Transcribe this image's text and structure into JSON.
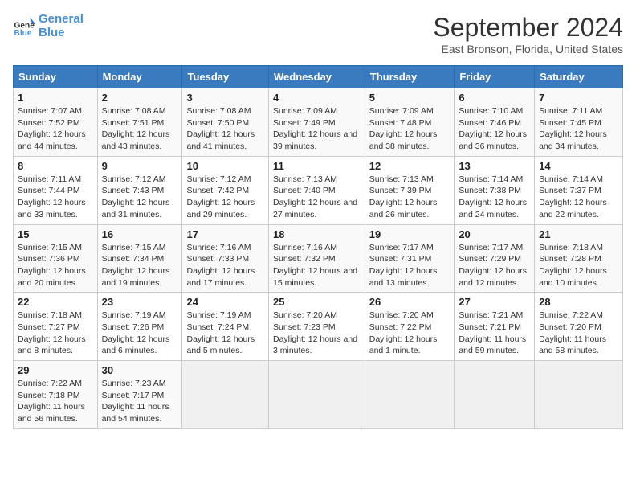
{
  "header": {
    "logo_line1": "General",
    "logo_line2": "Blue",
    "title": "September 2024",
    "subtitle": "East Bronson, Florida, United States"
  },
  "columns": [
    "Sunday",
    "Monday",
    "Tuesday",
    "Wednesday",
    "Thursday",
    "Friday",
    "Saturday"
  ],
  "weeks": [
    [
      {
        "day": "1",
        "sunrise": "Sunrise: 7:07 AM",
        "sunset": "Sunset: 7:52 PM",
        "daylight": "Daylight: 12 hours and 44 minutes."
      },
      {
        "day": "2",
        "sunrise": "Sunrise: 7:08 AM",
        "sunset": "Sunset: 7:51 PM",
        "daylight": "Daylight: 12 hours and 43 minutes."
      },
      {
        "day": "3",
        "sunrise": "Sunrise: 7:08 AM",
        "sunset": "Sunset: 7:50 PM",
        "daylight": "Daylight: 12 hours and 41 minutes."
      },
      {
        "day": "4",
        "sunrise": "Sunrise: 7:09 AM",
        "sunset": "Sunset: 7:49 PM",
        "daylight": "Daylight: 12 hours and 39 minutes."
      },
      {
        "day": "5",
        "sunrise": "Sunrise: 7:09 AM",
        "sunset": "Sunset: 7:48 PM",
        "daylight": "Daylight: 12 hours and 38 minutes."
      },
      {
        "day": "6",
        "sunrise": "Sunrise: 7:10 AM",
        "sunset": "Sunset: 7:46 PM",
        "daylight": "Daylight: 12 hours and 36 minutes."
      },
      {
        "day": "7",
        "sunrise": "Sunrise: 7:11 AM",
        "sunset": "Sunset: 7:45 PM",
        "daylight": "Daylight: 12 hours and 34 minutes."
      }
    ],
    [
      {
        "day": "8",
        "sunrise": "Sunrise: 7:11 AM",
        "sunset": "Sunset: 7:44 PM",
        "daylight": "Daylight: 12 hours and 33 minutes."
      },
      {
        "day": "9",
        "sunrise": "Sunrise: 7:12 AM",
        "sunset": "Sunset: 7:43 PM",
        "daylight": "Daylight: 12 hours and 31 minutes."
      },
      {
        "day": "10",
        "sunrise": "Sunrise: 7:12 AM",
        "sunset": "Sunset: 7:42 PM",
        "daylight": "Daylight: 12 hours and 29 minutes."
      },
      {
        "day": "11",
        "sunrise": "Sunrise: 7:13 AM",
        "sunset": "Sunset: 7:40 PM",
        "daylight": "Daylight: 12 hours and 27 minutes."
      },
      {
        "day": "12",
        "sunrise": "Sunrise: 7:13 AM",
        "sunset": "Sunset: 7:39 PM",
        "daylight": "Daylight: 12 hours and 26 minutes."
      },
      {
        "day": "13",
        "sunrise": "Sunrise: 7:14 AM",
        "sunset": "Sunset: 7:38 PM",
        "daylight": "Daylight: 12 hours and 24 minutes."
      },
      {
        "day": "14",
        "sunrise": "Sunrise: 7:14 AM",
        "sunset": "Sunset: 7:37 PM",
        "daylight": "Daylight: 12 hours and 22 minutes."
      }
    ],
    [
      {
        "day": "15",
        "sunrise": "Sunrise: 7:15 AM",
        "sunset": "Sunset: 7:36 PM",
        "daylight": "Daylight: 12 hours and 20 minutes."
      },
      {
        "day": "16",
        "sunrise": "Sunrise: 7:15 AM",
        "sunset": "Sunset: 7:34 PM",
        "daylight": "Daylight: 12 hours and 19 minutes."
      },
      {
        "day": "17",
        "sunrise": "Sunrise: 7:16 AM",
        "sunset": "Sunset: 7:33 PM",
        "daylight": "Daylight: 12 hours and 17 minutes."
      },
      {
        "day": "18",
        "sunrise": "Sunrise: 7:16 AM",
        "sunset": "Sunset: 7:32 PM",
        "daylight": "Daylight: 12 hours and 15 minutes."
      },
      {
        "day": "19",
        "sunrise": "Sunrise: 7:17 AM",
        "sunset": "Sunset: 7:31 PM",
        "daylight": "Daylight: 12 hours and 13 minutes."
      },
      {
        "day": "20",
        "sunrise": "Sunrise: 7:17 AM",
        "sunset": "Sunset: 7:29 PM",
        "daylight": "Daylight: 12 hours and 12 minutes."
      },
      {
        "day": "21",
        "sunrise": "Sunrise: 7:18 AM",
        "sunset": "Sunset: 7:28 PM",
        "daylight": "Daylight: 12 hours and 10 minutes."
      }
    ],
    [
      {
        "day": "22",
        "sunrise": "Sunrise: 7:18 AM",
        "sunset": "Sunset: 7:27 PM",
        "daylight": "Daylight: 12 hours and 8 minutes."
      },
      {
        "day": "23",
        "sunrise": "Sunrise: 7:19 AM",
        "sunset": "Sunset: 7:26 PM",
        "daylight": "Daylight: 12 hours and 6 minutes."
      },
      {
        "day": "24",
        "sunrise": "Sunrise: 7:19 AM",
        "sunset": "Sunset: 7:24 PM",
        "daylight": "Daylight: 12 hours and 5 minutes."
      },
      {
        "day": "25",
        "sunrise": "Sunrise: 7:20 AM",
        "sunset": "Sunset: 7:23 PM",
        "daylight": "Daylight: 12 hours and 3 minutes."
      },
      {
        "day": "26",
        "sunrise": "Sunrise: 7:20 AM",
        "sunset": "Sunset: 7:22 PM",
        "daylight": "Daylight: 12 hours and 1 minute."
      },
      {
        "day": "27",
        "sunrise": "Sunrise: 7:21 AM",
        "sunset": "Sunset: 7:21 PM",
        "daylight": "Daylight: 11 hours and 59 minutes."
      },
      {
        "day": "28",
        "sunrise": "Sunrise: 7:22 AM",
        "sunset": "Sunset: 7:20 PM",
        "daylight": "Daylight: 11 hours and 58 minutes."
      }
    ],
    [
      {
        "day": "29",
        "sunrise": "Sunrise: 7:22 AM",
        "sunset": "Sunset: 7:18 PM",
        "daylight": "Daylight: 11 hours and 56 minutes."
      },
      {
        "day": "30",
        "sunrise": "Sunrise: 7:23 AM",
        "sunset": "Sunset: 7:17 PM",
        "daylight": "Daylight: 11 hours and 54 minutes."
      },
      null,
      null,
      null,
      null,
      null
    ]
  ]
}
